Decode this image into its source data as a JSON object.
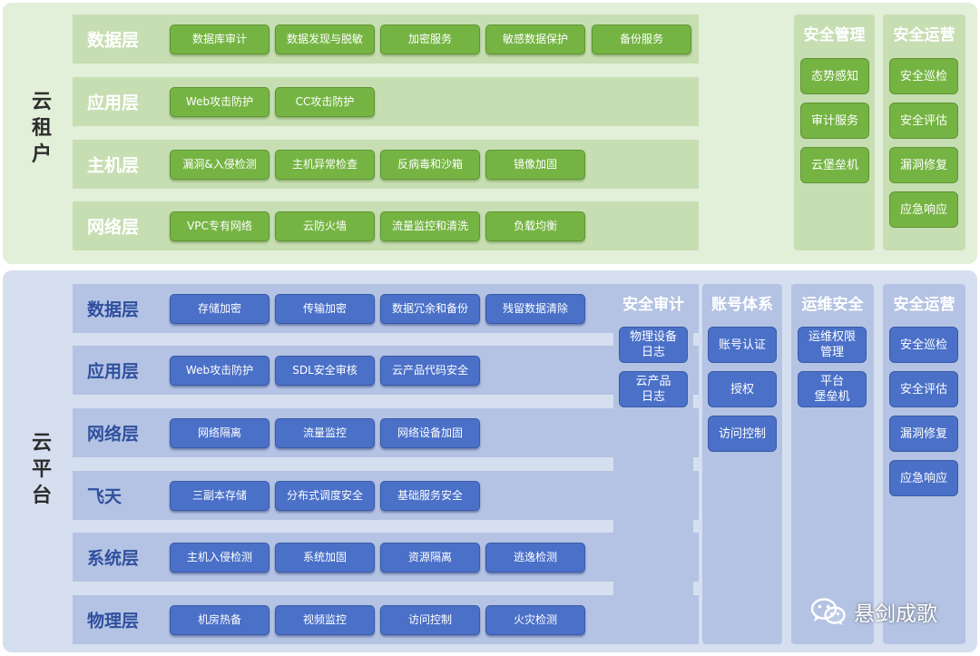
{
  "tenant": {
    "label": [
      "云",
      "租",
      "户"
    ],
    "layers": [
      {
        "title": "数据层",
        "items": [
          "数据库审计",
          "数据发现与脱敏",
          "加密服务",
          "敏感数据保护",
          "备份服务"
        ]
      },
      {
        "title": "应用层",
        "items": [
          "Web攻击防护",
          "CC攻击防护"
        ]
      },
      {
        "title": "主机层",
        "items": [
          "漏洞&入侵检测",
          "主机异常检查",
          "反病毒和沙箱",
          "镜像加固"
        ]
      },
      {
        "title": "网络层",
        "items": [
          "VPC专有网络",
          "云防火墙",
          "流量监控和清洗",
          "负载均衡"
        ]
      }
    ],
    "columns": [
      {
        "title": "安全管理",
        "items": [
          "态势感知",
          "审计服务",
          "云堡垒机"
        ]
      },
      {
        "title": "安全运营",
        "items": [
          "安全巡检",
          "安全评估",
          "漏洞修复",
          "应急响应"
        ]
      }
    ]
  },
  "platform": {
    "label": [
      "云",
      "平",
      "台"
    ],
    "layers": [
      {
        "title": "数据层",
        "items": [
          "存储加密",
          "传输加密",
          "数据冗余和备份",
          "残留数据清除"
        ]
      },
      {
        "title": "应用层",
        "items": [
          "Web攻击防护",
          "SDL安全审核",
          "云产品代码安全"
        ]
      },
      {
        "title": "网络层",
        "items": [
          "网络隔离",
          "流量监控",
          "网络设备加固"
        ]
      },
      {
        "title": "飞天",
        "items": [
          "三副本存储",
          "分布式调度安全",
          "基础服务安全"
        ]
      },
      {
        "title": "系统层",
        "items": [
          "主机入侵检测",
          "系统加固",
          "资源隔离",
          "逃逸检测"
        ]
      },
      {
        "title": "物理层",
        "items": [
          "机房热备",
          "视频监控",
          "访问控制",
          "火灾检测"
        ]
      }
    ],
    "columns": [
      {
        "title": "安全审计",
        "items": [
          "物理设备\n日志",
          "云产品\n日志"
        ]
      },
      {
        "title": "账号体系",
        "items": [
          "账号认证",
          "授权",
          "访问控制"
        ]
      },
      {
        "title": "运维安全",
        "items": [
          "运维权限\n管理",
          "平台\n堡垒机"
        ]
      },
      {
        "title": "安全运营",
        "items": [
          "安全巡检",
          "安全评估",
          "漏洞修复",
          "应急响应"
        ]
      }
    ]
  },
  "watermark": {
    "text": "悬剑成歌",
    "icon": "wechat-icon"
  },
  "colors": {
    "tenant_bg": "#e2efd9",
    "tenant_row": "#c7deb3",
    "tenant_chip": "#75b443",
    "tenant_title": "#ffffff",
    "platform_bg": "#d6dff0",
    "platform_row": "#b4c3e3",
    "platform_chip": "#4a70c8",
    "platform_title": "#2f4f9e"
  }
}
